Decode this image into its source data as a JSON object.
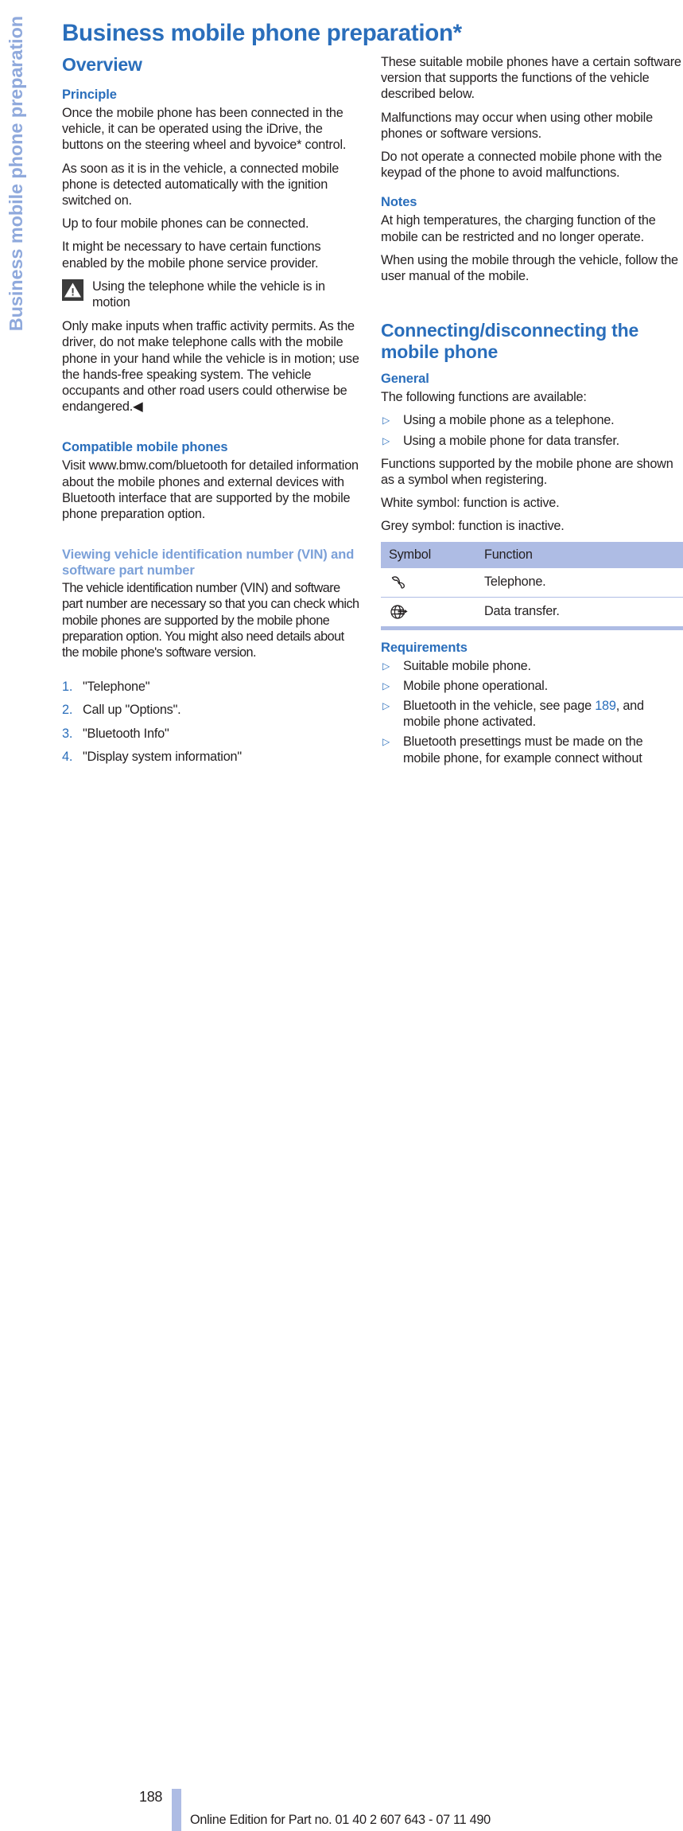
{
  "side_tab": {
    "label": "Business mobile phone preparation"
  },
  "page_title": "Business mobile phone preparation*",
  "left_column": {
    "overview_heading": "Overview",
    "principle_heading": "Principle",
    "principle_paragraphs": [
      "Once the mobile phone has been connected in the vehicle, it can be operated using the iDrive, the buttons on the steering wheel and byvoice* control.",
      "As soon as it is in the vehicle, a connected mobile phone is detected automatically with the ignition switched on.",
      "Up to four mobile phones can be connected.",
      "It might be necessary to have certain functions enabled by the mobile phone service provider."
    ],
    "warning": {
      "icon": "warning-triangle-icon",
      "title": "Using the telephone while the vehicle is in motion",
      "body": "Only make inputs when traffic activity permits. As the driver, do not make telephone calls with the mobile phone in your hand while the vehicle is in motion; use the hands-free speaking system. The vehicle occupants and other road users could otherwise be endangered.◀"
    },
    "compatible_heading": "Compatible mobile phones",
    "compatible_paragraph": "Visit www.bmw.com/bluetooth for detailed information about the mobile phones and external devices with Bluetooth interface that are supported by the mobile phone preparation option.",
    "vin_heading": "Viewing vehicle identification number (VIN) and software part number",
    "vin_paragraph": "The vehicle identification number (VIN) and software part number are necessary so that you can check which mobile phones are supported by the mobile phone preparation option. You might also need details about the mobile phone's software version.",
    "steps": [
      {
        "num": "1.",
        "text": "\"Telephone\""
      },
      {
        "num": "2.",
        "text": "Call up \"Options\"."
      },
      {
        "num": "3.",
        "text": "\"Bluetooth Info\""
      },
      {
        "num": "4.",
        "text": "\"Display system information\""
      }
    ]
  },
  "right_column": {
    "intro_paragraphs": [
      "These suitable mobile phones have a certain software version that supports the functions of the vehicle described below.",
      "Malfunctions may occur when using other mobile phones or software versions.",
      "Do not operate a connected mobile phone with the keypad of the phone to avoid malfunctions."
    ],
    "notes_heading": "Notes",
    "notes_paragraphs": [
      "At high temperatures, the charging function of the mobile can be restricted and no longer operate.",
      "When using the mobile through the vehicle, follow the user manual of the mobile."
    ],
    "connecting_heading": "Connecting/disconnecting the mobile phone",
    "general_heading": "General",
    "general_intro": "The following functions are available:",
    "general_bullets": [
      "Using a mobile phone as a telephone.",
      "Using a mobile phone for data transfer."
    ],
    "general_paragraphs": [
      "Functions supported by the mobile phone are shown as a symbol when registering.",
      "White symbol: function is active.",
      "Grey symbol: function is inactive."
    ],
    "symbol_table": {
      "headers": [
        "Symbol",
        "Function"
      ],
      "rows": [
        {
          "icon": "telephone-handset-icon",
          "function": "Telephone."
        },
        {
          "icon": "globe-data-transfer-icon",
          "function": "Data transfer."
        }
      ]
    },
    "requirements_heading": "Requirements",
    "requirements": [
      {
        "text": "Suitable mobile phone.",
        "pageref": null,
        "tail": null
      },
      {
        "text": "Mobile phone operational.",
        "pageref": null,
        "tail": null
      },
      {
        "text": "Bluetooth in the vehicle, see page ",
        "pageref": "189",
        "tail": ", and mobile phone activated."
      },
      {
        "text": "Bluetooth presettings must be made on the mobile phone, for example connect without",
        "pageref": null,
        "tail": null
      }
    ]
  },
  "footer": {
    "page_number": "188",
    "note": "Online Edition for Part no. 01 40 2 607 643 - 07 11 490"
  },
  "colors": {
    "heading_blue": "#2a6ebb",
    "light_blue": "#7ba0d8",
    "side_tab_blue": "#8fa9dc",
    "table_header": "#aebce4",
    "body_text": "#231f20"
  }
}
